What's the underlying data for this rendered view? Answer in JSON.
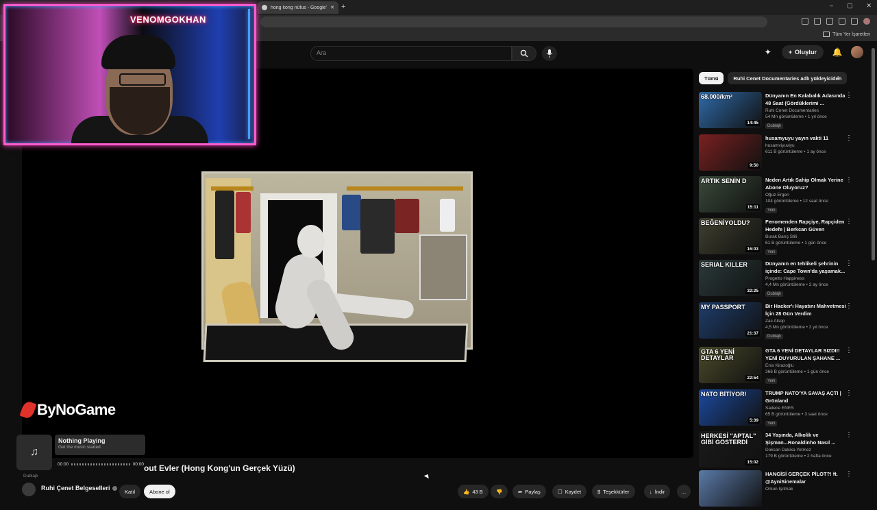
{
  "browser": {
    "tab_title": "hong kong nüfus - Google'da Ara",
    "new_tab": "+",
    "window_controls": [
      "–",
      "▢",
      "✕"
    ],
    "bookmarks_label": "Tüm Yer İşaretleri"
  },
  "header": {
    "search_placeholder": "Ara",
    "create_label": "Oluştur"
  },
  "overlay": {
    "webcam_sign": "VENOMGOKHAN",
    "watermark": "ByNoGame"
  },
  "music_widget": {
    "title": "Nothing Playing",
    "subtitle": "Get the music started",
    "time_start": "00:00",
    "time_end": "00:00",
    "note_icon": "♫"
  },
  "video": {
    "title_fragment": "out Evler (Hong Kong'un Gerçek Yüzü)",
    "dub_label": "Dublajlı",
    "channel": "Ruhi Çenet Belgeselleri",
    "join_label": "Katıl",
    "subscribe_label": "Abone ol",
    "likes": "43 B",
    "share_label": "Paylaş",
    "save_label": "Kaydet",
    "thanks_label": "Teşekkürler",
    "download_label": "İndir",
    "more_label": "…"
  },
  "sidebar": {
    "chips": [
      "Tümü",
      "Ruhi Cenet Documentaries adlı yükleyiciden"
    ],
    "items": [
      {
        "title": "Dünyanın En Kalabalık Adasında 48 Saat (Gördüklerimi ...",
        "channel": "Ruhi Cenet Documentaries",
        "meta": "54 Mn görüntüleme • 1 yıl önce",
        "badge": "Dublajlı",
        "duration": "14:45",
        "thumb_text": "68.000/km²",
        "thumb_color": "#2f6aa8"
      },
      {
        "title": "husamyuyu yayın vakti 11",
        "channel": "husamviyuviyu",
        "meta": "611 B görüntüleme • 1 ay önce",
        "badge": "",
        "duration": "9:50",
        "thumb_text": "",
        "thumb_color": "#7a2020"
      },
      {
        "title": "Neden Artık Sahip Olmak Yerine Abone Oluyoruz?",
        "channel": "Oğuz Ergen",
        "meta": "104 görüntüleme • 12 saat önce",
        "badge": "Yeni",
        "duration": "15:11",
        "thumb_text": "ARTIK SENİN D",
        "thumb_color": "#3a4a3a"
      },
      {
        "title": "Fenomenden Rapçiye, Rapçiden Hedefe | Berkcan Güven",
        "channel": "Burak Barış Stili",
        "meta": "61 B görüntüleme • 1 gün önce",
        "badge": "Yeni",
        "duration": "16:03",
        "thumb_text": "BEĞENİYOLDU?",
        "thumb_color": "#3f3f2f"
      },
      {
        "title": "Dünyanın en tehlikeli şehrinin içinde: Cape Town'da yaşamak...",
        "channel": "Progetto Happiness",
        "meta": "4,4 Mn görüntüleme • 2 ay önce",
        "badge": "Dublajlı",
        "duration": "32:25",
        "thumb_text": "SERIAL KILLER",
        "thumb_color": "#2a3a3a"
      },
      {
        "title": "Bir Hacker'ı Hayatını Mahvetmesi İçin 28 Gün Verdim",
        "channel": "Zac Alsop",
        "meta": "4,5 Mn görüntüleme • 2 yıl önce",
        "badge": "Dublajlı",
        "duration": "21:37",
        "thumb_text": "MY PASSPORT",
        "thumb_color": "#1e3d6b"
      },
      {
        "title": "GTA 6 YENİ DETAYLAR SIZDI!! YENİ DUYURULAN ŞAHANE ...",
        "channel": "Enis Kirazoğlu",
        "meta": "366 B görüntüleme • 1 gün önce",
        "badge": "Yeni",
        "duration": "22:54",
        "thumb_text": "GTA 6 YENİ DETAYLAR",
        "thumb_color": "#4a4a2a"
      },
      {
        "title": "TRUMP NATO'YA SAVAŞ AÇTI | Grönland",
        "channel": "Sadece ENES",
        "meta": "65 B görüntüleme • 3 saat önce",
        "badge": "Yeni",
        "duration": "5:39",
        "thumb_text": "NATO BİTİYOR!",
        "thumb_color": "#1b4aa0"
      },
      {
        "title": "34 Yaşında, Alkolik ve Şişman...Ronaldinho Nasıl ...",
        "channel": "Doksan Dakika Yetmez",
        "meta": "179 B görüntüleme • 2 hafta önce",
        "badge": "",
        "duration": "15:02",
        "thumb_text": "HERKESİ \"APTAL\" GİBİ GÖSTERDİ",
        "thumb_color": "#1a1a1a"
      },
      {
        "title": "HANGİSİ GERÇEK PİLOT?! ft. @AyniSinemalar",
        "channel": "Orkun Işıtmak",
        "meta": "",
        "badge": "",
        "duration": "",
        "thumb_text": "",
        "thumb_color": "#5a7aa8"
      }
    ]
  }
}
